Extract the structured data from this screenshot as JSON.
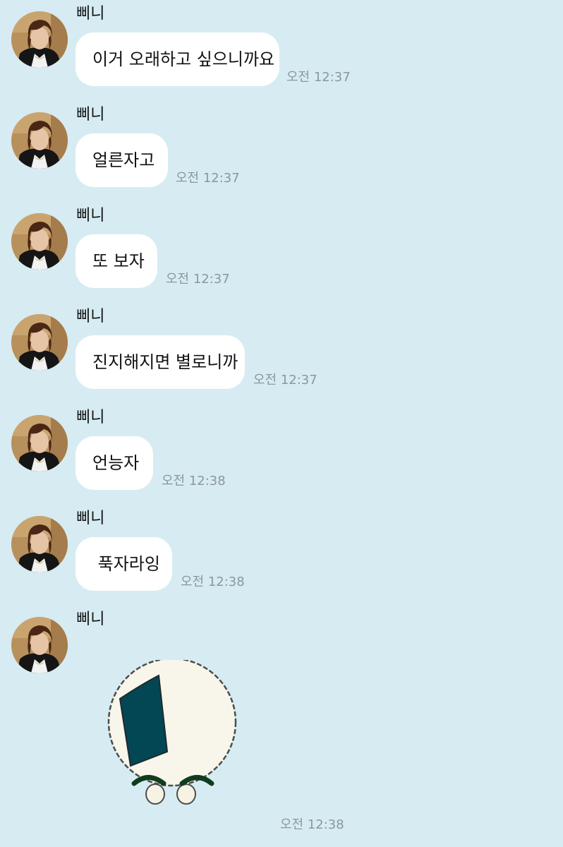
{
  "messages": [
    {
      "sender": "삐니",
      "text": "이거 오래하고 싶으니까요",
      "time": "오전 12:37"
    },
    {
      "sender": "삐니",
      "text": "얼른자고",
      "time": "오전 12:37"
    },
    {
      "sender": "삐니",
      "text": "또 보자",
      "time": "오전 12:37"
    },
    {
      "sender": "삐니",
      "text": "진지해지면 별로니까",
      "time": "오전 12:37"
    },
    {
      "sender": "삐니",
      "text": "언능자",
      "time": "오전 12:38"
    },
    {
      "sender": "삐니",
      "text": " 푹자라잉",
      "time": "오전 12:38"
    },
    {
      "sender": "삐니",
      "sticker": "rice-ball-sticker",
      "time": "오전 12:38"
    }
  ],
  "colors": {
    "background": "#d6ecf2",
    "bubble": "#ffffff",
    "time_text": "#8b979c",
    "sticker_seaweed": "#034654"
  }
}
